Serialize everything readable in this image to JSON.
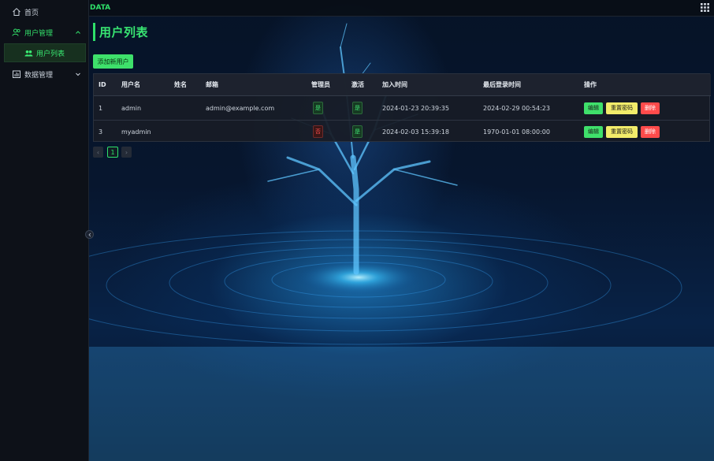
{
  "sidebar": {
    "items": [
      {
        "label": "首页",
        "icon": "home-icon"
      },
      {
        "label": "用户管理",
        "icon": "users-icon",
        "expanded": true,
        "children": [
          {
            "label": "用户列表",
            "icon": "user-group-icon",
            "active": true
          }
        ]
      },
      {
        "label": "数据管理",
        "icon": "chart-icon",
        "expanded": false
      }
    ]
  },
  "topbar": {
    "brand": "DATA",
    "right_icon": "apps-grid-icon"
  },
  "page": {
    "title": "用户列表",
    "add_button": "添加新用户"
  },
  "table": {
    "columns": [
      "ID",
      "用户名",
      "姓名",
      "邮箱",
      "管理员",
      "激活",
      "加入时间",
      "最后登录时间",
      "操作"
    ],
    "rows": [
      {
        "id": "1",
        "username": "admin",
        "name": "",
        "email": "admin@example.com",
        "admin": "是",
        "active": "是",
        "joined": "2024-01-23 20:39:35",
        "last_login": "2024-02-29 00:54:23"
      },
      {
        "id": "3",
        "username": "myadmin",
        "name": "",
        "email": "",
        "admin": "否",
        "active": "是",
        "joined": "2024-02-03 15:39:18",
        "last_login": "1970-01-01 08:00:00"
      }
    ],
    "actions": {
      "edit": "编辑",
      "reset": "重置密码",
      "delete": "删除"
    }
  },
  "pagination": {
    "prev": "‹",
    "current": "1",
    "next": "›"
  },
  "colors": {
    "accent": "#2fe06a",
    "danger": "#ff4b4b",
    "warning": "#f2ec6a",
    "sidebar_bg": "#0d1118"
  }
}
